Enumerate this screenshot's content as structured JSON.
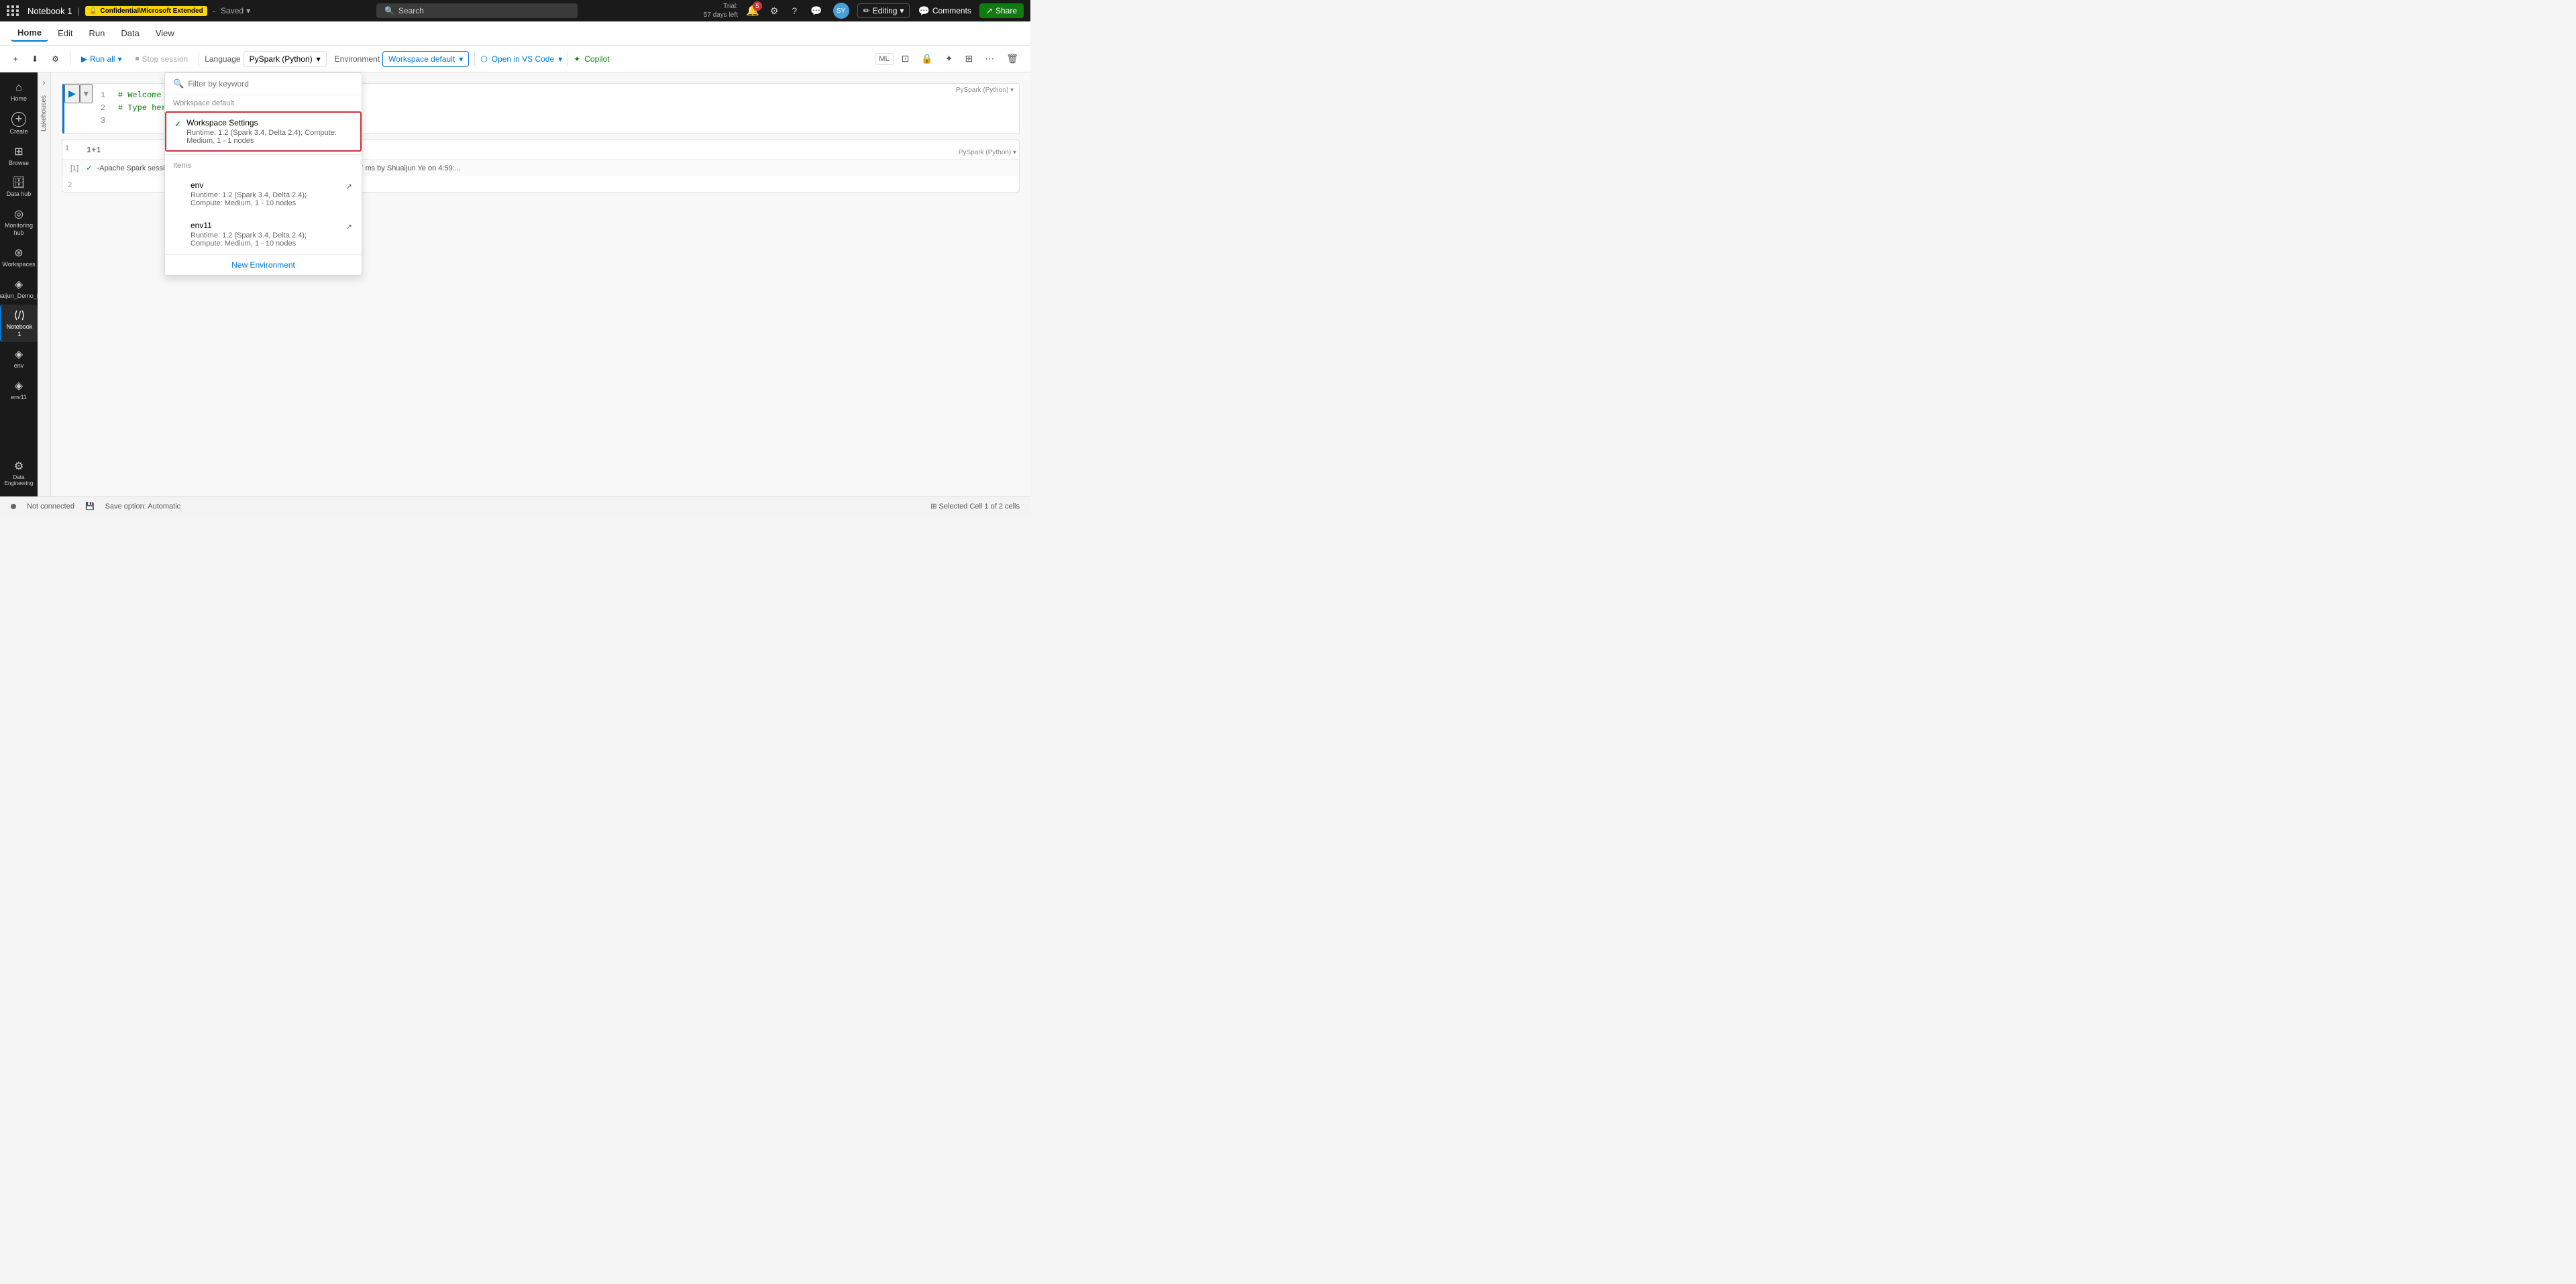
{
  "titleBar": {
    "notebookName": "Notebook 1",
    "breadcrumb": "Confidential\\Microsoft Extended",
    "saveStatus": "Saved",
    "searchPlaceholder": "Search",
    "trialText": "Trial:",
    "trialDays": "57 days left",
    "editingLabel": "Editing",
    "commentsLabel": "Comments",
    "shareLabel": "Share",
    "notifCount": "5"
  },
  "menuBar": {
    "items": [
      "Home",
      "Edit",
      "Run",
      "Data",
      "View"
    ]
  },
  "toolbar": {
    "runAll": "Run all",
    "stopSession": "Stop session",
    "language": "Language",
    "languageValue": "PySpark (Python)",
    "environment": "Environment",
    "environmentValue": "Workspace default",
    "openVSCode": "Open in VS Code",
    "copilot": "Copilot",
    "mlLabel": "ML"
  },
  "sidebar": {
    "items": [
      {
        "icon": "⌂",
        "label": "Home"
      },
      {
        "icon": "+",
        "label": "Create"
      },
      {
        "icon": "⊞",
        "label": "Browse"
      },
      {
        "icon": "⊡",
        "label": "Data hub"
      },
      {
        "icon": "◎",
        "label": "Monitoring hub"
      },
      {
        "icon": "⊛",
        "label": "Workspaces"
      },
      {
        "icon": "◈",
        "label": "Shuaijun_Demo_Env"
      },
      {
        "icon": "⟨/⟩",
        "label": "Notebook 1",
        "active": true
      },
      {
        "icon": "◈",
        "label": "env"
      },
      {
        "icon": "◈",
        "label": "env11"
      }
    ]
  },
  "nbSidebar": {
    "label": "Lakehouses"
  },
  "cells": [
    {
      "id": "cell-1",
      "lines": [
        "1",
        "2",
        "3"
      ],
      "code": [
        "# Welcome to your new notebook",
        "# Type here in the cell editor to add code!",
        ""
      ],
      "lineColor": "#0070c0"
    },
    {
      "id": "cell-2",
      "inputNum": "1",
      "code": "1+1",
      "outputNum": "[1]",
      "output": "-Apache Spark session ready in 15 sec 737 ms. Command executed in 2 sec 917 ms by Shuaijun Ye on 4:59:..."
    }
  ],
  "dropdown": {
    "filterPlaceholder": "Filter by keyword",
    "workspaceDefaultLabel": "Workspace default",
    "selectedItem": {
      "name": "Workspace Settings",
      "desc": "Runtime: 1.2 (Spark 3.4, Delta 2.4); Compute: Medium, 1 - 1 nodes",
      "checkmark": "✓"
    },
    "itemsLabel": "Items",
    "items": [
      {
        "name": "env",
        "desc": "Runtime: 1.2 (Spark 3.4, Delta 2.4); Compute: Medium, 1 - 10 nodes"
      },
      {
        "name": "env11",
        "desc": "Runtime: 1.2 (Spark 3.4, Delta 2.4); Compute: Medium, 1 - 10 nodes"
      }
    ],
    "newEnvironment": "New Environment"
  },
  "statusBar": {
    "connectionStatus": "Not connected",
    "saveOption": "Save option: Automatic",
    "selectedCell": "Selected Cell 1 of 2 cells"
  }
}
